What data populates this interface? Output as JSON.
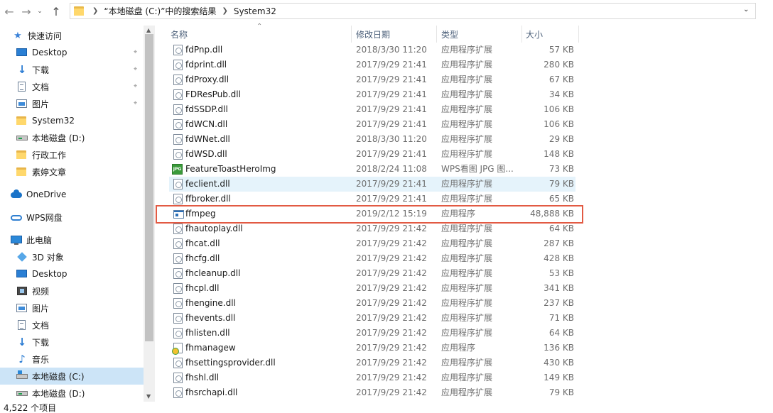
{
  "address": {
    "back_icon": "arrow-left-icon",
    "forward_icon": "arrow-right-icon",
    "history_icon": "chevron-down-icon",
    "up_icon": "arrow-up-icon",
    "crumbs": [
      "“本地磁盘 (C:)”中的搜索结果",
      "System32"
    ]
  },
  "sidebar": {
    "items": [
      {
        "label": "快速访问",
        "icon": "star-icon",
        "pinned": false
      },
      {
        "label": "Desktop",
        "icon": "desktop-icon",
        "pinned": true
      },
      {
        "label": "下载",
        "icon": "download-icon",
        "pinned": true
      },
      {
        "label": "文档",
        "icon": "documents-icon",
        "pinned": true
      },
      {
        "label": "图片",
        "icon": "pictures-icon",
        "pinned": true
      },
      {
        "label": "System32",
        "icon": "folder-icon",
        "pinned": false
      },
      {
        "label": "本地磁盘 (D:)",
        "icon": "drive-icon",
        "pinned": false
      },
      {
        "label": "行政工作",
        "icon": "folder-icon",
        "pinned": false
      },
      {
        "label": "素婷文章",
        "icon": "folder-icon",
        "pinned": false
      },
      {
        "label": "OneDrive",
        "icon": "cloud-icon",
        "pinned": false
      },
      {
        "label": "WPS网盘",
        "icon": "wps-cloud-icon",
        "pinned": false
      },
      {
        "label": "此电脑",
        "icon": "computer-icon",
        "pinned": false
      },
      {
        "label": "3D 对象",
        "icon": "3d-objects-icon",
        "pinned": false
      },
      {
        "label": "Desktop",
        "icon": "desktop-icon",
        "pinned": false
      },
      {
        "label": "视频",
        "icon": "videos-icon",
        "pinned": false
      },
      {
        "label": "图片",
        "icon": "pictures-icon",
        "pinned": false
      },
      {
        "label": "文档",
        "icon": "documents-icon",
        "pinned": false
      },
      {
        "label": "下载",
        "icon": "download-icon",
        "pinned": false
      },
      {
        "label": "音乐",
        "icon": "music-icon",
        "pinned": false
      },
      {
        "label": "本地磁盘 (C:)",
        "icon": "system-drive-icon",
        "pinned": false,
        "selected": true
      },
      {
        "label": "本地磁盘 (D:)",
        "icon": "drive-icon",
        "pinned": false
      }
    ]
  },
  "columns": {
    "name": "名称",
    "date": "修改日期",
    "type": "类型",
    "size": "大小"
  },
  "files": [
    {
      "name": "fdPnp.dll",
      "date": "2018/3/30 11:20",
      "type": "应用程序扩展",
      "size": "57 KB",
      "icon": "dll"
    },
    {
      "name": "fdprint.dll",
      "date": "2017/9/29 21:41",
      "type": "应用程序扩展",
      "size": "280 KB",
      "icon": "dll"
    },
    {
      "name": "fdProxy.dll",
      "date": "2017/9/29 21:41",
      "type": "应用程序扩展",
      "size": "67 KB",
      "icon": "dll"
    },
    {
      "name": "FDResPub.dll",
      "date": "2017/9/29 21:41",
      "type": "应用程序扩展",
      "size": "34 KB",
      "icon": "dll"
    },
    {
      "name": "fdSSDP.dll",
      "date": "2017/9/29 21:41",
      "type": "应用程序扩展",
      "size": "106 KB",
      "icon": "dll"
    },
    {
      "name": "fdWCN.dll",
      "date": "2017/9/29 21:41",
      "type": "应用程序扩展",
      "size": "106 KB",
      "icon": "dll"
    },
    {
      "name": "fdWNet.dll",
      "date": "2018/3/30 11:20",
      "type": "应用程序扩展",
      "size": "29 KB",
      "icon": "dll"
    },
    {
      "name": "fdWSD.dll",
      "date": "2017/9/29 21:41",
      "type": "应用程序扩展",
      "size": "148 KB",
      "icon": "dll"
    },
    {
      "name": "FeatureToastHeroImg",
      "date": "2018/2/24 11:08",
      "type": "WPS看图 JPG 图...",
      "size": "73 KB",
      "icon": "jpg"
    },
    {
      "name": "feclient.dll",
      "date": "2017/9/29 21:41",
      "type": "应用程序扩展",
      "size": "79 KB",
      "icon": "dll",
      "hover": true
    },
    {
      "name": "ffbroker.dll",
      "date": "2017/9/29 21:41",
      "type": "应用程序扩展",
      "size": "65 KB",
      "icon": "dll"
    },
    {
      "name": "ffmpeg",
      "date": "2019/2/12 15:19",
      "type": "应用程序",
      "size": "48,888 KB",
      "icon": "exe",
      "highlighted": true
    },
    {
      "name": "fhautoplay.dll",
      "date": "2017/9/29 21:42",
      "type": "应用程序扩展",
      "size": "64 KB",
      "icon": "dll"
    },
    {
      "name": "fhcat.dll",
      "date": "2017/9/29 21:42",
      "type": "应用程序扩展",
      "size": "287 KB",
      "icon": "dll"
    },
    {
      "name": "fhcfg.dll",
      "date": "2017/9/29 21:42",
      "type": "应用程序扩展",
      "size": "428 KB",
      "icon": "dll"
    },
    {
      "name": "fhcleanup.dll",
      "date": "2017/9/29 21:42",
      "type": "应用程序扩展",
      "size": "53 KB",
      "icon": "dll"
    },
    {
      "name": "fhcpl.dll",
      "date": "2017/9/29 21:42",
      "type": "应用程序扩展",
      "size": "341 KB",
      "icon": "dll"
    },
    {
      "name": "fhengine.dll",
      "date": "2017/9/29 21:42",
      "type": "应用程序扩展",
      "size": "237 KB",
      "icon": "dll"
    },
    {
      "name": "fhevents.dll",
      "date": "2017/9/29 21:42",
      "type": "应用程序扩展",
      "size": "71 KB",
      "icon": "dll"
    },
    {
      "name": "fhlisten.dll",
      "date": "2017/9/29 21:42",
      "type": "应用程序扩展",
      "size": "64 KB",
      "icon": "dll"
    },
    {
      "name": "fhmanagew",
      "date": "2017/9/29 21:42",
      "type": "应用程序",
      "size": "136 KB",
      "icon": "app"
    },
    {
      "name": "fhsettingsprovider.dll",
      "date": "2017/9/29 21:42",
      "type": "应用程序扩展",
      "size": "430 KB",
      "icon": "dll"
    },
    {
      "name": "fhshl.dll",
      "date": "2017/9/29 21:42",
      "type": "应用程序扩展",
      "size": "149 KB",
      "icon": "dll"
    },
    {
      "name": "fhsrchapi.dll",
      "date": "2017/9/29 21:42",
      "type": "应用程序扩展",
      "size": "79 KB",
      "icon": "dll"
    }
  ],
  "status": {
    "item_count": "4,522 个项目"
  },
  "colors": {
    "highlight_border": "#e25a43",
    "selected_bg": "#cce4f7",
    "hover_bg": "#e5f3fb"
  }
}
